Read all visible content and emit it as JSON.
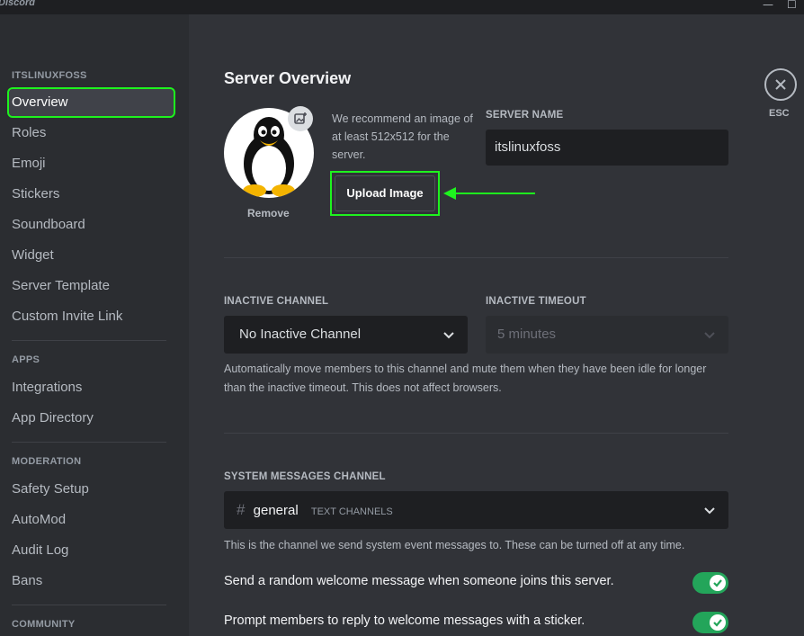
{
  "app": {
    "brand": "Discord",
    "minimize": "—",
    "maximize": "☐"
  },
  "sidebar": {
    "server_header": "ITSLINUXFOSS",
    "server_items": [
      {
        "label": "Overview",
        "selected": true
      },
      {
        "label": "Roles"
      },
      {
        "label": "Emoji"
      },
      {
        "label": "Stickers"
      },
      {
        "label": "Soundboard"
      },
      {
        "label": "Widget"
      },
      {
        "label": "Server Template"
      },
      {
        "label": "Custom Invite Link"
      }
    ],
    "apps_header": "APPS",
    "apps_items": [
      {
        "label": "Integrations"
      },
      {
        "label": "App Directory"
      }
    ],
    "moderation_header": "MODERATION",
    "moderation_items": [
      {
        "label": "Safety Setup"
      },
      {
        "label": "AutoMod"
      },
      {
        "label": "Audit Log"
      },
      {
        "label": "Bans"
      }
    ],
    "community_header": "COMMUNITY"
  },
  "main": {
    "title": "Server Overview",
    "avatar": {
      "remove_label": "Remove",
      "icon": "image-plus-icon"
    },
    "recommend_text": "We recommend an image of at least 512x512 for the server.",
    "upload_label": "Upload Image",
    "server_name": {
      "label": "SERVER NAME",
      "value": "itslinuxfoss"
    },
    "inactive_channel": {
      "label": "INACTIVE CHANNEL",
      "value": "No Inactive Channel"
    },
    "inactive_timeout": {
      "label": "INACTIVE TIMEOUT",
      "value": "5 minutes"
    },
    "inactive_help": "Automatically move members to this channel and mute them when they have been idle for longer than the inactive timeout. This does not affect browsers.",
    "system_channel": {
      "label": "SYSTEM MESSAGES CHANNEL",
      "hash": "#",
      "value": "general",
      "category": "TEXT CHANNELS",
      "help": "This is the channel we send system event messages to. These can be turned off at any time."
    },
    "toggles": [
      {
        "label": "Send a random welcome message when someone joins this server.",
        "on": true
      },
      {
        "label": "Prompt members to reply to welcome messages with a sticker.",
        "on": true
      }
    ],
    "esc_label": "ESC"
  },
  "colors": {
    "highlight": "#1ef21e",
    "toggle_on": "#23a55a",
    "bg_main": "#313338",
    "bg_sidebar": "#2b2d31"
  }
}
